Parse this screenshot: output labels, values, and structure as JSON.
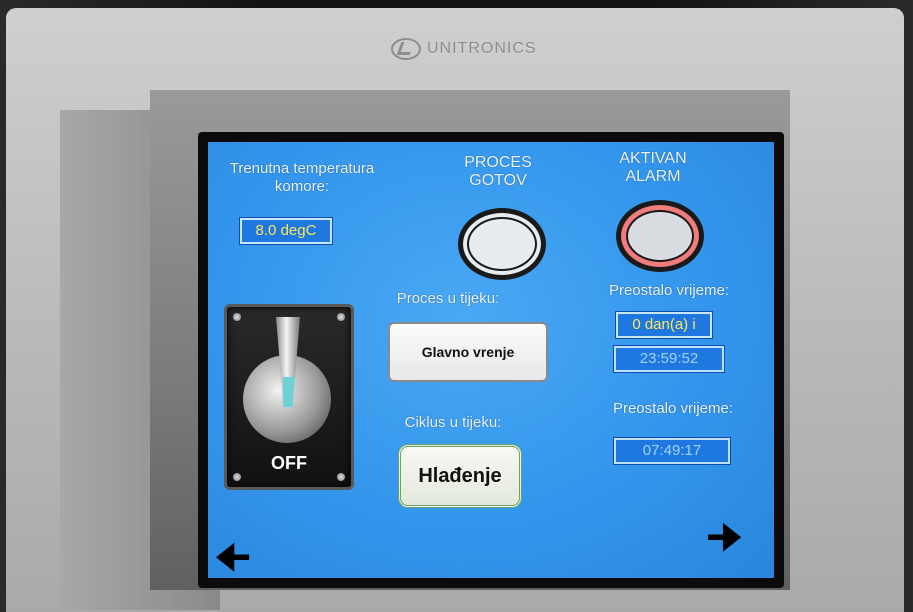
{
  "device": {
    "brand": "UNITRONICS"
  },
  "screen": {
    "temperature": {
      "label": "Trenutna temperatura komore:",
      "value": "8.0 degC"
    },
    "process_done": {
      "label": "PROCES GOTOV"
    },
    "alarm": {
      "label": "AKTIVAN ALARM"
    },
    "process": {
      "label": "Proces u tijeku:",
      "value": "Glavno vrenje"
    },
    "cycle": {
      "label": "Ciklus u tijeku:",
      "value": "Hlađenje"
    },
    "remaining1": {
      "label": "Preostalo vrijeme:",
      "days": "0 dan(a) i",
      "time": "23:59:52"
    },
    "remaining2": {
      "label": "Preostalo vrijeme:",
      "time": "07:49:17"
    },
    "switch": {
      "state": "OFF"
    },
    "nav": {
      "left_icon": "arrow-left-icon",
      "right_icon": "arrow-right-icon"
    }
  },
  "colors": {
    "screen_blue": "#3396ec",
    "field_text": "#ffe65a",
    "alarm_ring": "#f27b7b"
  }
}
